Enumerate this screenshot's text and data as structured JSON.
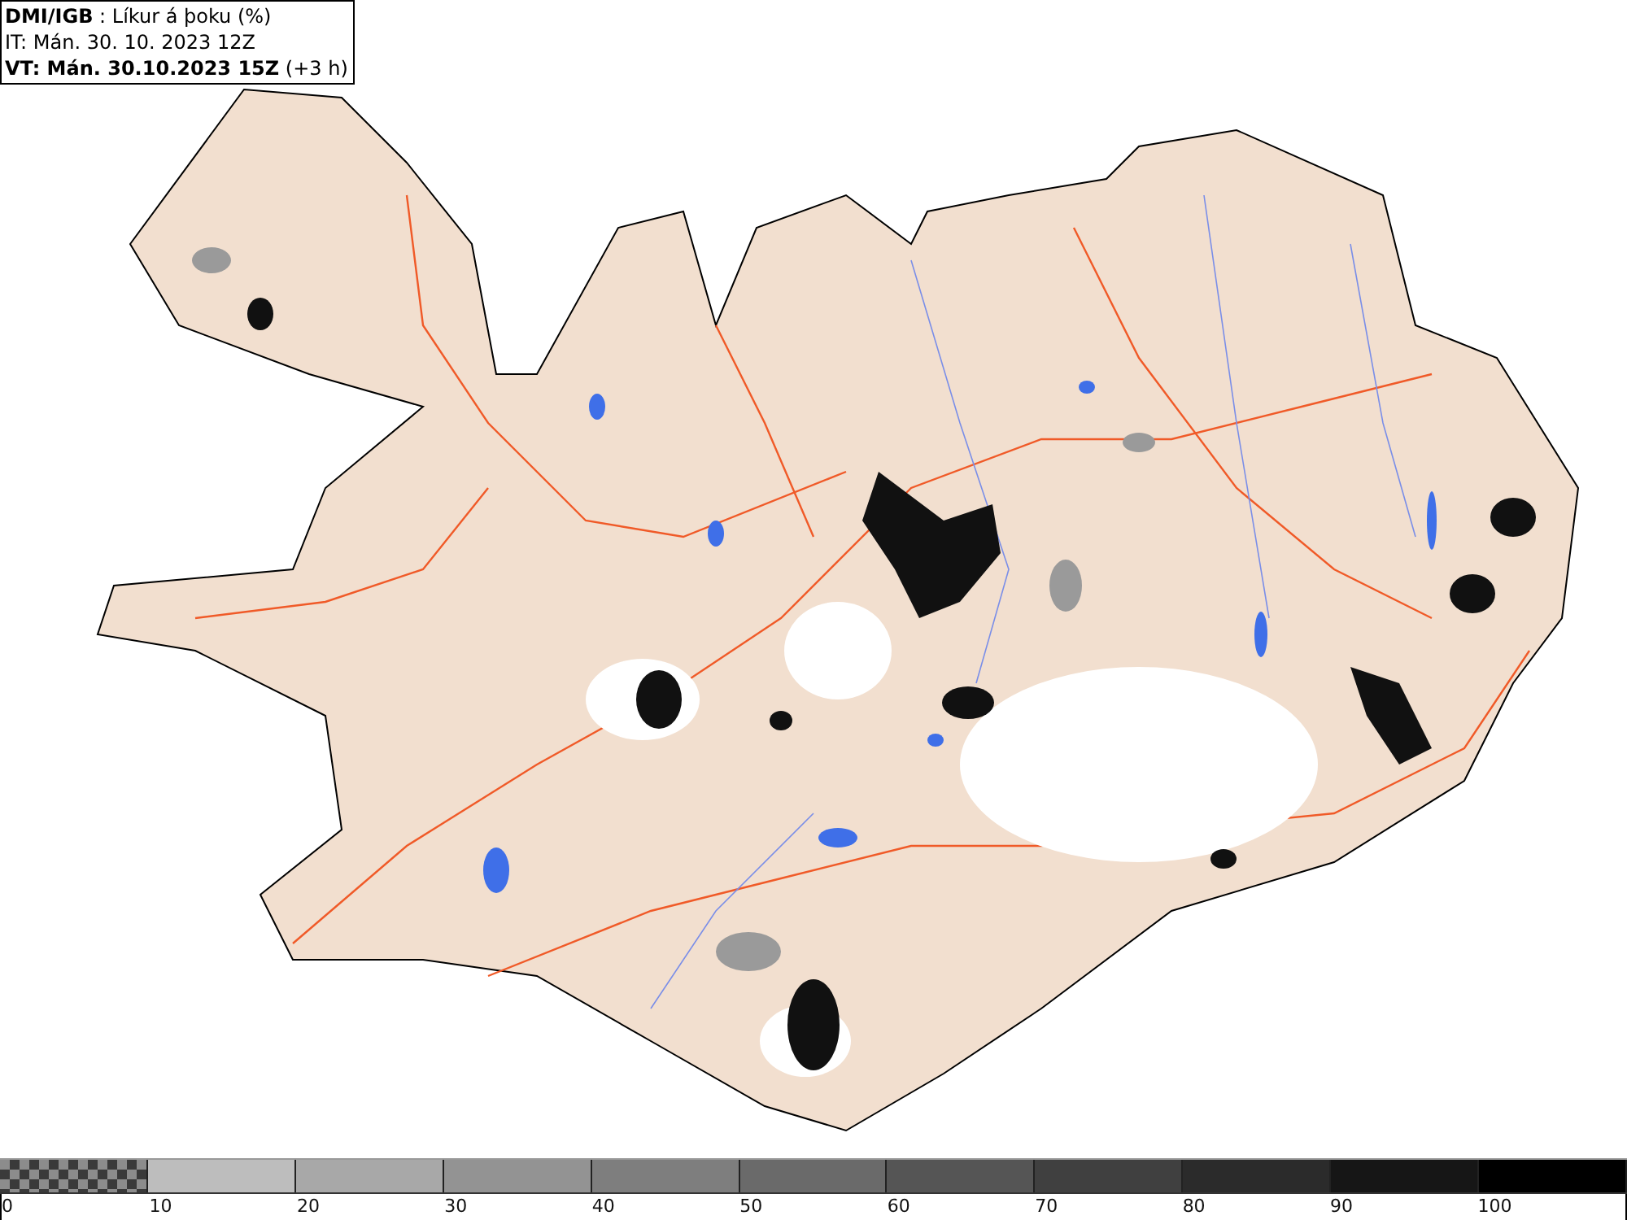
{
  "header": {
    "lines": [
      "**DMI/IGB** : Líkur á þoku (%)",
      "IT: Mán. 30. 10. 2023 12Z",
      "**VT: Mán. 30.10.2023 15Z** (+3 h)"
    ]
  },
  "legend": {
    "segments": [
      {
        "kind": "checker",
        "color": "#3a3a3a"
      },
      {
        "kind": "solid",
        "color": "#bdbdbd"
      },
      {
        "kind": "solid",
        "color": "#a8a8a8"
      },
      {
        "kind": "solid",
        "color": "#939393"
      },
      {
        "kind": "solid",
        "color": "#7e7e7e"
      },
      {
        "kind": "solid",
        "color": "#6a6a6a"
      },
      {
        "kind": "solid",
        "color": "#555555"
      },
      {
        "kind": "solid",
        "color": "#404040"
      },
      {
        "kind": "solid",
        "color": "#2b2b2b"
      },
      {
        "kind": "solid",
        "color": "#161616"
      },
      {
        "kind": "solid",
        "color": "#000000"
      }
    ],
    "ticks": [
      "0",
      "10",
      "20",
      "30",
      "40",
      "50",
      "60",
      "70",
      "80",
      "90",
      "100"
    ]
  }
}
